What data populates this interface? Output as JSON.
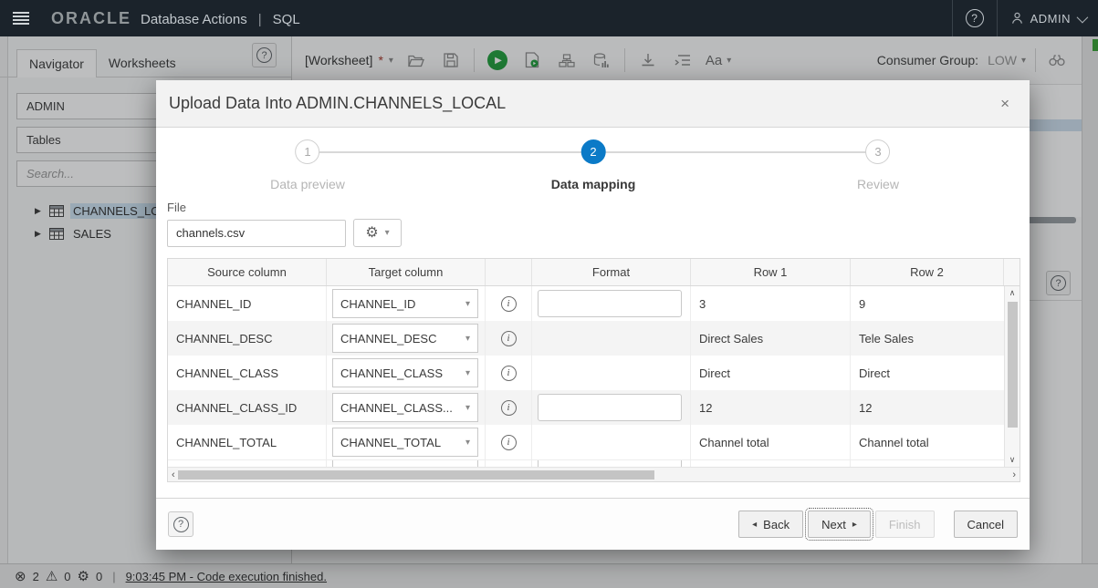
{
  "colors": {
    "topbar_bg": "#1b232b",
    "accent": "#0b7ac7",
    "run_green": "#23a03f",
    "modified_star": "#a5382c",
    "selection": "#cfe3f3"
  },
  "icons": {
    "help": "?",
    "info": "i",
    "gear": "⚙",
    "error_circle": "⊗",
    "warning": "⚠",
    "close": "×",
    "caret_down": "▾",
    "play": "▶",
    "back_arrow": "◂",
    "next_arrow": "▸",
    "tree_expand": "▶",
    "scroll_left": "‹",
    "scroll_right": "›",
    "scroll_up": "∧",
    "scroll_down": "∨"
  },
  "topbar": {
    "logo": "ORACLE",
    "app_title": "Database Actions",
    "separator": "|",
    "app_context": "SQL",
    "user": "ADMIN"
  },
  "sidebar": {
    "tabs": [
      {
        "label": "Navigator"
      },
      {
        "label": "Worksheets"
      }
    ],
    "schema_select": "ADMIN",
    "object_type_select": "Tables",
    "search_placeholder": "Search...",
    "tree": [
      {
        "label": "CHANNELS_LOC"
      },
      {
        "label": "SALES"
      }
    ]
  },
  "toolbar": {
    "worksheet_label": "[Worksheet]",
    "modified_indicator": "*",
    "font_label": "Aa",
    "consumer_group_label": "Consumer Group:",
    "consumer_group_value": "LOW"
  },
  "modal": {
    "title": "Upload Data Into ADMIN.CHANNELS_LOCAL",
    "steps": [
      {
        "number": "1",
        "label": "Data preview"
      },
      {
        "number": "2",
        "label": "Data mapping"
      },
      {
        "number": "3",
        "label": "Review"
      }
    ],
    "file": {
      "label": "File",
      "value": "channels.csv"
    },
    "table": {
      "headers": [
        "Source column",
        "Target column",
        "",
        "Format",
        "Row 1",
        "Row 2"
      ],
      "rows": [
        {
          "source": "CHANNEL_ID",
          "target": "CHANNEL_ID",
          "row1": "3",
          "row2": "9"
        },
        {
          "source": "CHANNEL_DESC",
          "target": "CHANNEL_DESC",
          "row1": "Direct Sales",
          "row2": "Tele Sales"
        },
        {
          "source": "CHANNEL_CLASS",
          "target": "CHANNEL_CLASS",
          "row1": "Direct",
          "row2": "Direct"
        },
        {
          "source": "CHANNEL_CLASS_ID",
          "target": "CHANNEL_CLASS...",
          "row1": "12",
          "row2": "12"
        },
        {
          "source": "CHANNEL_TOTAL",
          "target": "CHANNEL_TOTAL",
          "row1": "Channel total",
          "row2": "Channel total"
        }
      ]
    },
    "footer": {
      "back": "Back",
      "next": "Next",
      "finish": "Finish",
      "cancel": "Cancel"
    }
  },
  "statusbar": {
    "errors_count": "2",
    "warnings_count": "0",
    "tasks_count": "0",
    "separator": "|",
    "message": "9:03:45 PM - Code execution finished."
  }
}
